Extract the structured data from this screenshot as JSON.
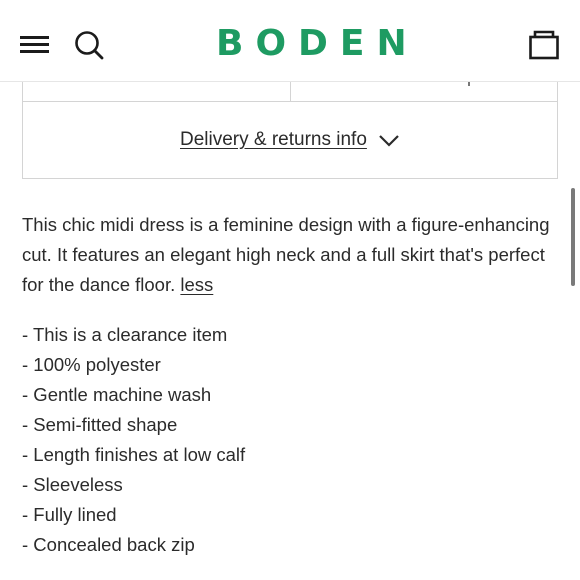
{
  "header": {
    "logo_text": "BODEN",
    "brand_color": "#1e9b62",
    "icons": [
      "hamburger-menu-icon",
      "search-icon",
      "shopping-bag-icon"
    ]
  },
  "delivery": {
    "label": "Delivery & returns info",
    "icon": "chevron-down-icon"
  },
  "description": {
    "text": "This chic midi dress is a feminine design with a figure-enhancing cut. It features an elegant high neck and a full skirt that's perfect for the dance floor.",
    "less_label": "less"
  },
  "features": [
    "- This is a clearance item",
    "- 100% polyester",
    "- Gentle machine wash",
    "- Semi-fitted shape",
    "- Length finishes at low calf",
    "- Sleeveless",
    "- Fully lined",
    "- Concealed back zip"
  ]
}
